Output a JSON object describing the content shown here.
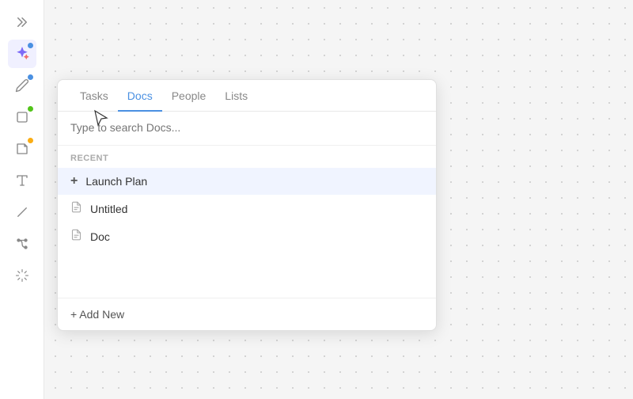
{
  "background": {
    "dot_color": "#c8c8c8"
  },
  "sidebar": {
    "icons": [
      {
        "name": "arrow-icon",
        "symbol": "▷",
        "dot": null
      },
      {
        "name": "magic-icon",
        "symbol": "✦",
        "dot": "blue",
        "active": true
      },
      {
        "name": "pencil-icon",
        "symbol": "✏",
        "dot": "blue"
      },
      {
        "name": "shape-icon",
        "symbol": "□",
        "dot": "green"
      },
      {
        "name": "sticky-icon",
        "symbol": "◱",
        "dot": "yellow"
      },
      {
        "name": "text-icon",
        "symbol": "T",
        "dot": null
      },
      {
        "name": "line-icon",
        "symbol": "⟋",
        "dot": null
      },
      {
        "name": "connector-icon",
        "symbol": "⌥",
        "dot": null
      },
      {
        "name": "sparkle-icon",
        "symbol": "✳",
        "dot": null
      }
    ]
  },
  "popup": {
    "tabs": [
      {
        "label": "Tasks",
        "active": false
      },
      {
        "label": "Docs",
        "active": true
      },
      {
        "label": "People",
        "active": false
      },
      {
        "label": "Lists",
        "active": false
      }
    ],
    "search_placeholder": "Type to search Docs...",
    "search_value": "",
    "recent_label": "RECENT",
    "items": [
      {
        "id": "launch-plan",
        "label": "Launch Plan",
        "icon": "plus",
        "highlighted": true
      },
      {
        "id": "untitled",
        "label": "Untitled",
        "icon": "doc",
        "highlighted": false
      },
      {
        "id": "doc",
        "label": "Doc",
        "icon": "doc",
        "highlighted": false
      }
    ],
    "add_new_label": "+ Add New"
  }
}
